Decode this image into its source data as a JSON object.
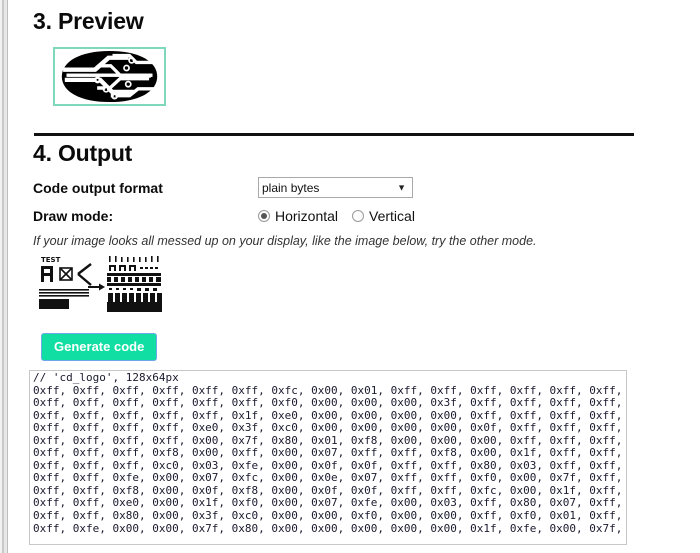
{
  "preview": {
    "title": "3. Preview",
    "image_alt": "cd_logo-circuit-preview",
    "border_color": "#7fd8bb"
  },
  "output": {
    "title": "4. Output",
    "format_label": "Code output format",
    "format_value": "plain bytes",
    "format_options": [
      "plain bytes"
    ],
    "select_caret": "▼",
    "draw_mode_label": "Draw mode:",
    "draw_modes": [
      {
        "label": "Horizontal",
        "checked": true
      },
      {
        "label": "Vertical",
        "checked": false
      }
    ],
    "hint": "If your image looks all messed up on your display, like the image below, try the other mode.",
    "hint_figure_label": "TEST",
    "generate_button": "Generate code",
    "generate_button_color": "#11dea2"
  },
  "code": {
    "header": "// 'cd_logo', 128x64px",
    "lines": [
      "0xff, 0xff, 0xff, 0xff, 0xff, 0xff, 0xfc, 0x00, 0x01, 0xff, 0xff, 0xff, 0xff, 0xff, 0xff, 0xff",
      "0xff, 0xff, 0xff, 0xff, 0xff, 0xff, 0xf0, 0x00, 0x00, 0x00, 0x3f, 0xff, 0xff, 0xff, 0xff, 0xff",
      "0xff, 0xff, 0xff, 0xff, 0xff, 0x1f, 0xe0, 0x00, 0x00, 0x00, 0x00, 0xff, 0xff, 0xff, 0xff, 0xff",
      "0xff, 0xff, 0xff, 0xff, 0xe0, 0x3f, 0xc0, 0x00, 0x00, 0x00, 0x00, 0x0f, 0xff, 0xff, 0xff, 0xff",
      "0xff, 0xff, 0xff, 0xff, 0x00, 0x7f, 0x80, 0x01, 0xf8, 0x00, 0x00, 0x00, 0xff, 0xff, 0xff, 0xff",
      "0xff, 0xff, 0xff, 0xf8, 0x00, 0xff, 0x00, 0x07, 0xff, 0xff, 0xf8, 0x00, 0x1f, 0xff, 0xff, 0xff",
      "0xff, 0xff, 0xff, 0xc0, 0x03, 0xfe, 0x00, 0x0f, 0x0f, 0xff, 0xff, 0x80, 0x03, 0xff, 0xff, 0xff",
      "0xff, 0xff, 0xfe, 0x00, 0x07, 0xfc, 0x00, 0x0e, 0x07, 0xff, 0xff, 0xf0, 0x00, 0x7f, 0xff, 0xff",
      "0xff, 0xff, 0xf8, 0x00, 0x0f, 0xf8, 0x00, 0x0f, 0x0f, 0xff, 0xff, 0xfc, 0x00, 0x1f, 0xff, 0xff",
      "0xff, 0xff, 0xe0, 0x00, 0x1f, 0xf0, 0x00, 0x07, 0xfe, 0x00, 0x03, 0xff, 0x80, 0x07, 0xff, 0xff",
      "0xff, 0xff, 0x80, 0x00, 0x3f, 0xc0, 0x00, 0x00, 0xf0, 0x00, 0x00, 0xff, 0xf0, 0x01, 0xff, 0xff",
      "0xff, 0xfe, 0x00, 0x00, 0x7f, 0x80, 0x00, 0x00, 0x00, 0x00, 0x00, 0x1f, 0xfe, 0x00, 0x7f, 0xff"
    ]
  }
}
